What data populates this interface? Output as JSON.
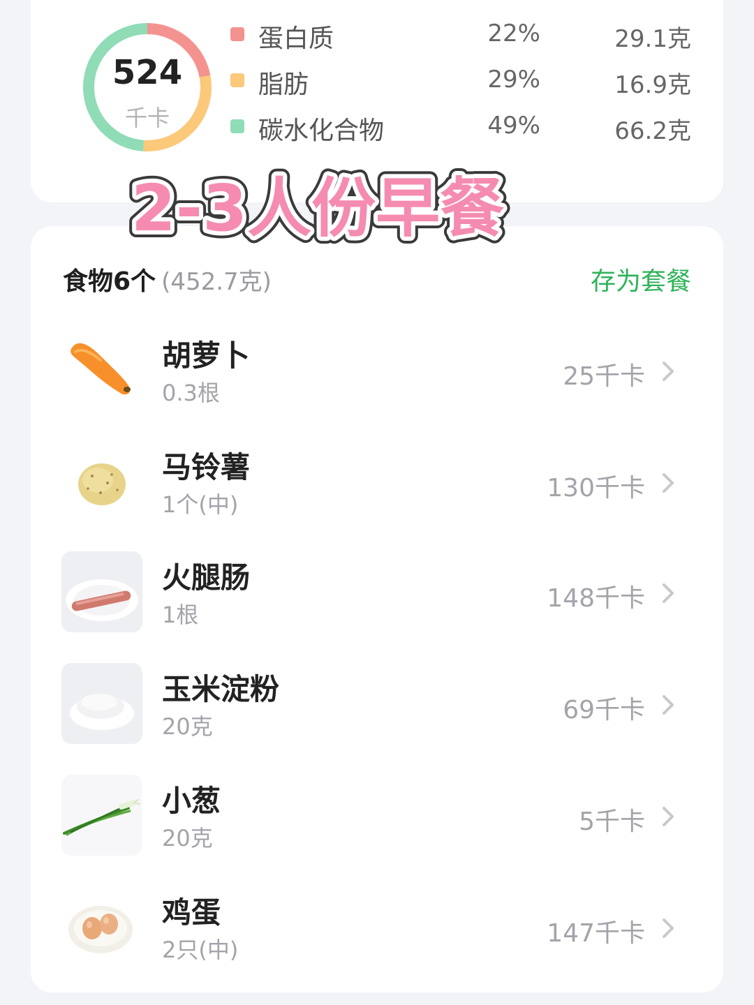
{
  "summary": {
    "calories_value": "524",
    "calories_unit": "千卡",
    "macros": [
      {
        "name": "蛋白质",
        "percent": "22%",
        "amount": "29.1克",
        "color": "#f4928f",
        "share": 0.22
      },
      {
        "name": "脂肪",
        "percent": "29%",
        "amount": "16.9克",
        "color": "#fcc87a",
        "share": 0.29
      },
      {
        "name": "碳水化合物",
        "percent": "49%",
        "amount": "66.2克",
        "color": "#8fdcb7",
        "share": 0.49
      }
    ]
  },
  "overlay_title": "2-3人份早餐",
  "foods": {
    "title": "食物6个",
    "total_weight": "(452.7克)",
    "save_label": "存为套餐",
    "save_color": "#2fb35a",
    "items": [
      {
        "name": "胡萝卜",
        "quantity": "0.3根",
        "calories": "25千卡",
        "icon": "carrot-icon"
      },
      {
        "name": "马铃薯",
        "quantity": "1个(中)",
        "calories": "130千卡",
        "icon": "potato-icon"
      },
      {
        "name": "火腿肠",
        "quantity": "1根",
        "calories": "148千卡",
        "icon": "sausage-icon"
      },
      {
        "name": "玉米淀粉",
        "quantity": "20克",
        "calories": "69千卡",
        "icon": "cornstarch-icon"
      },
      {
        "name": "小葱",
        "quantity": "20克",
        "calories": "5千卡",
        "icon": "scallion-icon"
      },
      {
        "name": "鸡蛋",
        "quantity": "2只(中)",
        "calories": "147千卡",
        "icon": "egg-icon"
      }
    ]
  }
}
